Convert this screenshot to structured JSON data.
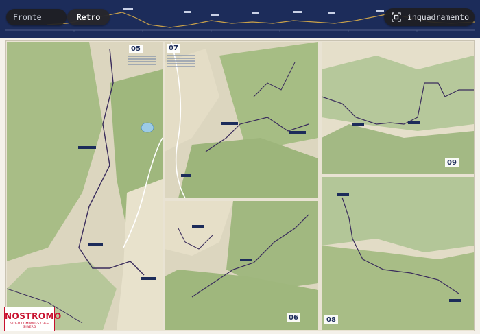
{
  "toolbar": {
    "front_label": "Fronte",
    "back_label": "Retro",
    "frame_label": "inquadramento"
  },
  "sheet": {
    "tiles": [
      {
        "label": "05"
      },
      {
        "label": "07"
      },
      {
        "label": "09"
      },
      {
        "label": "06"
      },
      {
        "label": "08"
      }
    ]
  },
  "logo": {
    "word": "NOSTROMO",
    "subtitle": "VIDEO COMPANIES CHES SYNERG"
  },
  "colors": {
    "topbar": "#1c2c5a",
    "route": "#3a2c5c",
    "terrain_green": "#9fb77d",
    "terrain_light": "#dcd6bf",
    "logo_red": "#c8102e"
  }
}
